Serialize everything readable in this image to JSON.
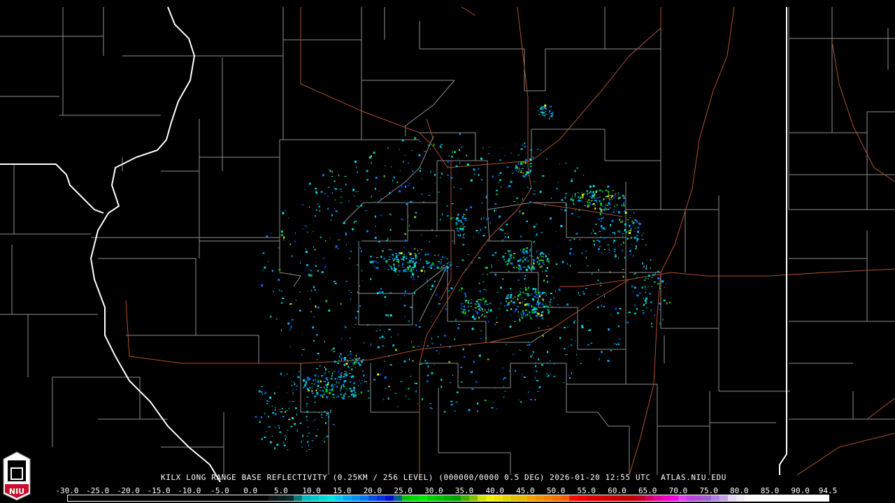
{
  "caption": {
    "station": "KILX",
    "product": "LONG RANGE BASE REFLECTIVITY (0.25KM / 256 LEVEL) (000000/0000 0.5 DEG)",
    "datetime": "2026-01-20 12:55 UTC",
    "source": "ATLAS.NIU.EDU"
  },
  "logo": {
    "text": "NIU"
  },
  "colorbar": {
    "min": -30.0,
    "max": 94.5,
    "tick_labels": [
      "-30.0",
      "-25.0",
      "-20.0",
      "-15.0",
      "-10.0",
      "-5.0",
      "0.0",
      "5.0",
      "10.0",
      "15.0",
      "20.0",
      "25.0",
      "30.0",
      "35.0",
      "40.0",
      "45.0",
      "50.0",
      "55.0",
      "60.0",
      "65.0",
      "70.0",
      "75.0",
      "80.0",
      "85.0",
      "90.0",
      "94.5"
    ],
    "colors": [
      "#000000",
      "#000000",
      "#000000",
      "#000000",
      "#000000",
      "#000000",
      "#000000",
      "#000000",
      "#000000",
      "#000000",
      "#000000",
      "#000000",
      "#000000",
      "#000000",
      "#000000",
      "#000000",
      "#000000",
      "#000000",
      "#000000",
      "#000000",
      "#000000",
      "#000000",
      "#000000",
      "#000000",
      "#0a1414",
      "#0a1e1e",
      "#0a2828",
      "#007878",
      "#00bcbc",
      "#00c8c8",
      "#00d8d8",
      "#00e4e4",
      "#00c8f0",
      "#00a8f0",
      "#0090f0",
      "#0078f0",
      "#0050e0",
      "#0030e0",
      "#0010d0",
      "#006090",
      "#00c800",
      "#00d800",
      "#00e800",
      "#00d000",
      "#00c000",
      "#00b000",
      "#00a000",
      "#40b000",
      "#80c000",
      "#d0e000",
      "#f0f000",
      "#f0e000",
      "#e8d000",
      "#e0c000",
      "#e8b800",
      "#f0a000",
      "#f09000",
      "#f08000",
      "#f07000",
      "#f06000",
      "#f01000",
      "#f00000",
      "#e00000",
      "#d80000",
      "#d00000",
      "#c80000",
      "#c00000",
      "#c00000",
      "#c00020",
      "#d00060",
      "#e000a0",
      "#f000c0",
      "#f000e0",
      "#e040f0",
      "#c040e0",
      "#b050d0",
      "#a060d0",
      "#b080e0",
      "#c8a0e8",
      "#e8d8f4",
      "#f4ecf8",
      "#ffffff",
      "#ffffff",
      "#ffffff",
      "#ffffff",
      "#ffffff",
      "#ffffff",
      "#ffffff",
      "#ffffff",
      "#ffffff",
      "#ffffff"
    ]
  },
  "colors": {
    "state_border": "#ffffff",
    "county": "#9a9a9a",
    "highway": "#b0502a"
  }
}
